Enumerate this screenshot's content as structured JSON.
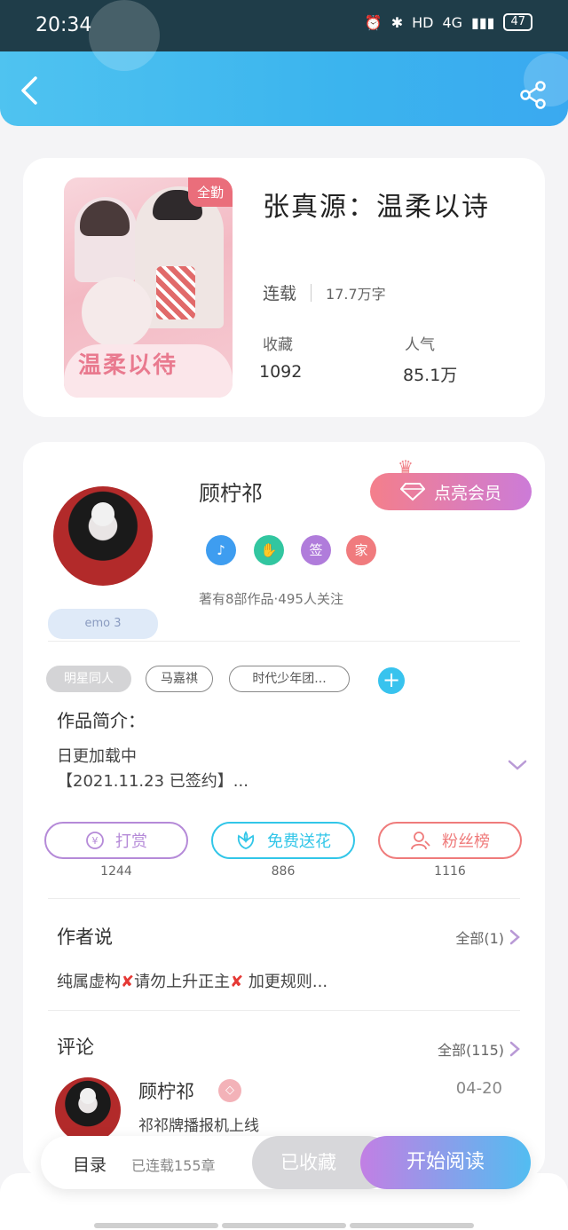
{
  "status_bar": {
    "time": "20:34",
    "network": "4G",
    "hd": "HD",
    "battery": "47"
  },
  "header": {
    "back_icon": "chevron-left-icon",
    "share_icon": "share-icon"
  },
  "book": {
    "cover_badge": "全勤",
    "cover_title": "温柔以待",
    "title": "张真源：温柔以诗",
    "status": "连载",
    "word_count": "17.7万字",
    "favorites_label": "收藏",
    "favorites_value": "1092",
    "popularity_label": "人气",
    "popularity_value": "85.1万"
  },
  "author": {
    "name": "顾柠祁",
    "vip_button": "点亮会员",
    "badges": [
      "♪",
      "✋",
      "签",
      "家"
    ],
    "badge_colors": [
      "#3e9df0",
      "#32c6a0",
      "#b07cdb",
      "#f07b7e"
    ],
    "meta": "著有8部作品·495人关注",
    "emo_tag": "emo 3"
  },
  "tags": [
    "明星同人",
    "马嘉祺",
    "时代少年团..."
  ],
  "intro": {
    "title": "作品简介：",
    "line1": "日更加载中",
    "line2": "【2021.11.23 已签约】..."
  },
  "actions": [
    {
      "label": "打赏",
      "count": "1244",
      "color": "#b58ad8"
    },
    {
      "label": "免费送花",
      "count": "886",
      "color": "#32c6e8"
    },
    {
      "label": "粉丝榜",
      "count": "1116",
      "color": "#ef7b7b"
    }
  ],
  "author_says": {
    "title": "作者说",
    "more": "全部(1)",
    "text_a": "纯属虚构",
    "text_b": "请勿上升正主",
    "text_c": " 加更规则..."
  },
  "comments": {
    "title": "评论",
    "more": "全部(115)",
    "items": [
      {
        "name": "顾柠祁",
        "date": "04-20",
        "text": "祁祁牌播报机上线"
      }
    ]
  },
  "bottom_bar": {
    "toc": "目录",
    "chapters": "已连载155章",
    "collected": "已收藏",
    "read": "开始阅读"
  }
}
